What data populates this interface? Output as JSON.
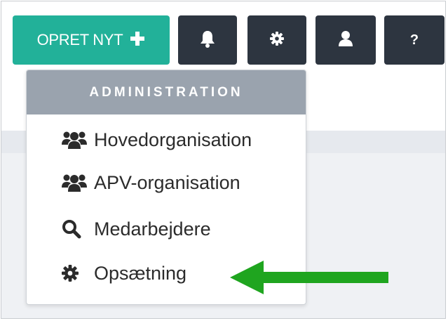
{
  "toolbar": {
    "create_label": "OPRET NYT",
    "create_icon": "plus-icon",
    "help_label": "?",
    "icons": [
      "bell-icon",
      "gear-icon",
      "user-icon",
      "help-icon"
    ]
  },
  "dropdown": {
    "header": "ADMINISTRATION",
    "items": [
      {
        "label": "Hovedorganisation",
        "icon": "users-icon"
      },
      {
        "label": "APV-organisation",
        "icon": "users-icon"
      },
      {
        "label": "Medarbejdere",
        "icon": "search-icon"
      },
      {
        "label": "Opsætning",
        "icon": "gear-icon"
      }
    ]
  },
  "colors": {
    "create_button": "#22b199",
    "dark_button": "#2d3540",
    "dropdown_header": "#9aa3ae",
    "arrow": "#1fa51f"
  }
}
